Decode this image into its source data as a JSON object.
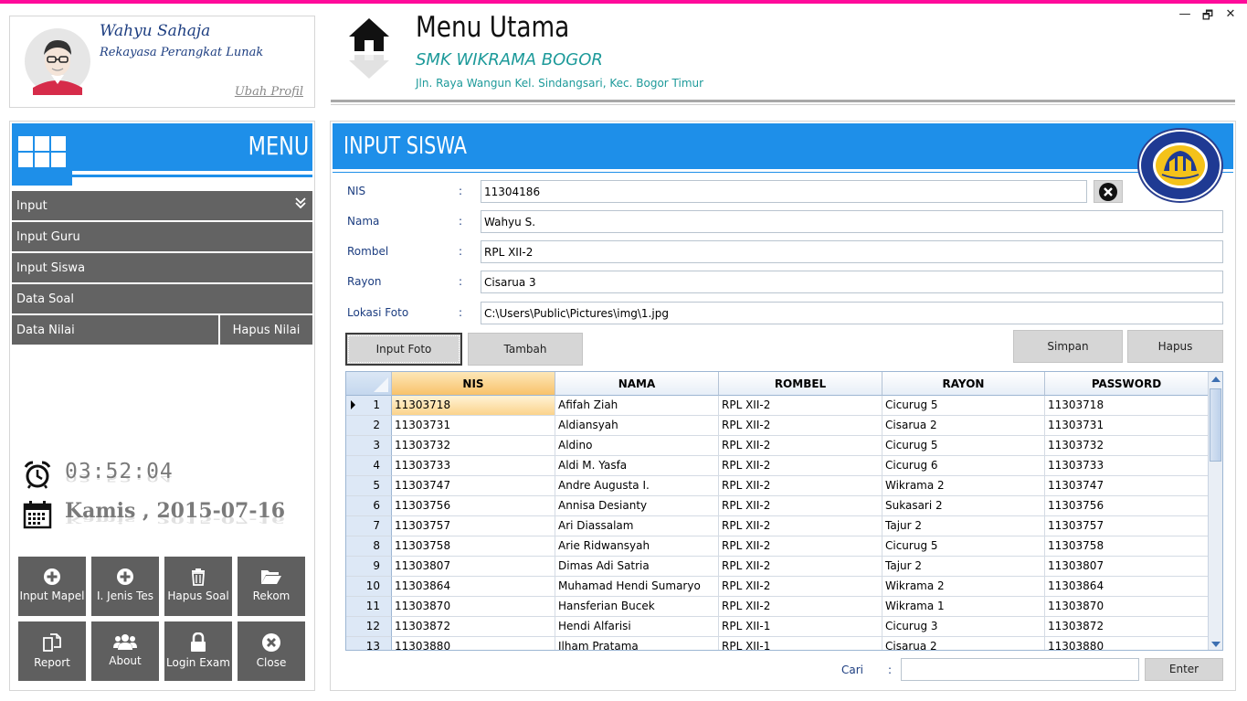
{
  "window": {
    "controls": {
      "minimize": "—",
      "restore": "🗗",
      "close": "✕"
    }
  },
  "profile": {
    "name": "Wahyu Sahaja",
    "role": "Rekayasa Perangkat Lunak",
    "edit_link": "Ubah Profil"
  },
  "header": {
    "title": "Menu Utama",
    "school": "SMK WIKRAMA BOGOR",
    "address": "Jln. Raya Wangun  Kel. Sindangsari, Kec. Bogor Timur",
    "icon": "home-icon"
  },
  "sidebar": {
    "menu_label": "MENU",
    "items": [
      {
        "label": "Input",
        "icon": "chevron-double-down-icon"
      },
      {
        "label": "Input Guru"
      },
      {
        "label": "Input Siswa"
      },
      {
        "label": "Data Soal"
      },
      {
        "label": "Data Nilai"
      },
      {
        "label": "Hapus Nilai"
      }
    ],
    "time": "03:52:04",
    "date": "Kamis , 2015-07-16",
    "tiles": [
      {
        "label": "Input Mapel",
        "icon": "plus-circle-icon"
      },
      {
        "label": "I. Jenis Tes",
        "icon": "plus-circle-icon"
      },
      {
        "label": "Hapus Soal",
        "icon": "trash-icon"
      },
      {
        "label": "Rekom",
        "icon": "folder-open-icon"
      },
      {
        "label": "Report",
        "icon": "copy-icon"
      },
      {
        "label": "About",
        "icon": "users-icon"
      },
      {
        "label": "Login Exam",
        "icon": "lock-icon"
      },
      {
        "label": "Close",
        "icon": "close-circle-icon"
      }
    ]
  },
  "form": {
    "title": "INPUT SISWA",
    "logo_text": "SMK WIKRAMA KOTA BOGOR",
    "fields": [
      {
        "label": "NIS",
        "colon": ":",
        "value": "11304186"
      },
      {
        "label": "Nama",
        "colon": ":",
        "value": "Wahyu S."
      },
      {
        "label": "Rombel",
        "colon": ":",
        "value": "RPL XII-2"
      },
      {
        "label": "Rayon",
        "colon": ":",
        "value": "Cisarua 3"
      },
      {
        "label": "Lokasi Foto",
        "colon": ":",
        "value": "C:\\Users\\Public\\Pictures\\img\\1.jpg"
      }
    ],
    "buttons": {
      "input_foto": "Input Foto",
      "tambah": "Tambah",
      "simpan": "Simpan",
      "hapus": "Hapus"
    }
  },
  "table": {
    "columns": [
      "NIS",
      "NAMA",
      "ROMBEL",
      "RAYON",
      "PASSWORD"
    ],
    "rows": [
      {
        "no": "1",
        "nis": "11303718",
        "nama": "Afifah Ziah",
        "rombel": "RPL XII-2",
        "rayon": "Cicurug 5",
        "password": "11303718"
      },
      {
        "no": "2",
        "nis": "11303731",
        "nama": "Aldiansyah",
        "rombel": "RPL XII-2",
        "rayon": "Cisarua 2",
        "password": "11303731"
      },
      {
        "no": "3",
        "nis": "11303732",
        "nama": "Aldino",
        "rombel": "RPL XII-2",
        "rayon": "Cicurug 5",
        "password": "11303732"
      },
      {
        "no": "4",
        "nis": "11303733",
        "nama": "Aldi M. Yasfa",
        "rombel": "RPL XII-2",
        "rayon": "Cicurug 6",
        "password": "11303733"
      },
      {
        "no": "5",
        "nis": "11303747",
        "nama": "Andre Augusta I.",
        "rombel": "RPL XII-2",
        "rayon": "Wikrama 2",
        "password": "11303747"
      },
      {
        "no": "6",
        "nis": "11303756",
        "nama": "Annisa Desianty",
        "rombel": "RPL XII-2",
        "rayon": "Sukasari 2",
        "password": "11303756"
      },
      {
        "no": "7",
        "nis": "11303757",
        "nama": "Ari Diassalam",
        "rombel": "RPL XII-2",
        "rayon": "Tajur 2",
        "password": "11303757"
      },
      {
        "no": "8",
        "nis": "11303758",
        "nama": "Arie Ridwansyah",
        "rombel": "RPL XII-2",
        "rayon": "Cicurug 5",
        "password": "11303758"
      },
      {
        "no": "9",
        "nis": "11303807",
        "nama": "Dimas Adi Satria",
        "rombel": "RPL XII-2",
        "rayon": "Tajur 2",
        "password": "11303807"
      },
      {
        "no": "10",
        "nis": "11303864",
        "nama": "Muhamad Hendi Sumaryo",
        "rombel": "RPL XII-2",
        "rayon": "Wikrama 2",
        "password": "11303864"
      },
      {
        "no": "11",
        "nis": "11303870",
        "nama": "Hansferian Bucek",
        "rombel": "RPL XII-2",
        "rayon": "Wikrama 1",
        "password": "11303870"
      },
      {
        "no": "12",
        "nis": "11303872",
        "nama": "Hendi Alfarisi",
        "rombel": "RPL XII-1",
        "rayon": "Cicurug 3",
        "password": "11303872"
      },
      {
        "no": "13",
        "nis": "11303880",
        "nama": "Ilham Pratama",
        "rombel": "RPL XII-1",
        "rayon": "Cisarua 2",
        "password": "11303880"
      }
    ],
    "selected_row": "1"
  },
  "search": {
    "label": "Cari",
    "colon": ":",
    "value": "",
    "button": "Enter"
  },
  "colors": {
    "accent": "#1e8fe9",
    "topbar": "#ff0a9a",
    "tile": "#5f5f5f",
    "label": "#1c3d80",
    "school": "#1d9a9a"
  }
}
